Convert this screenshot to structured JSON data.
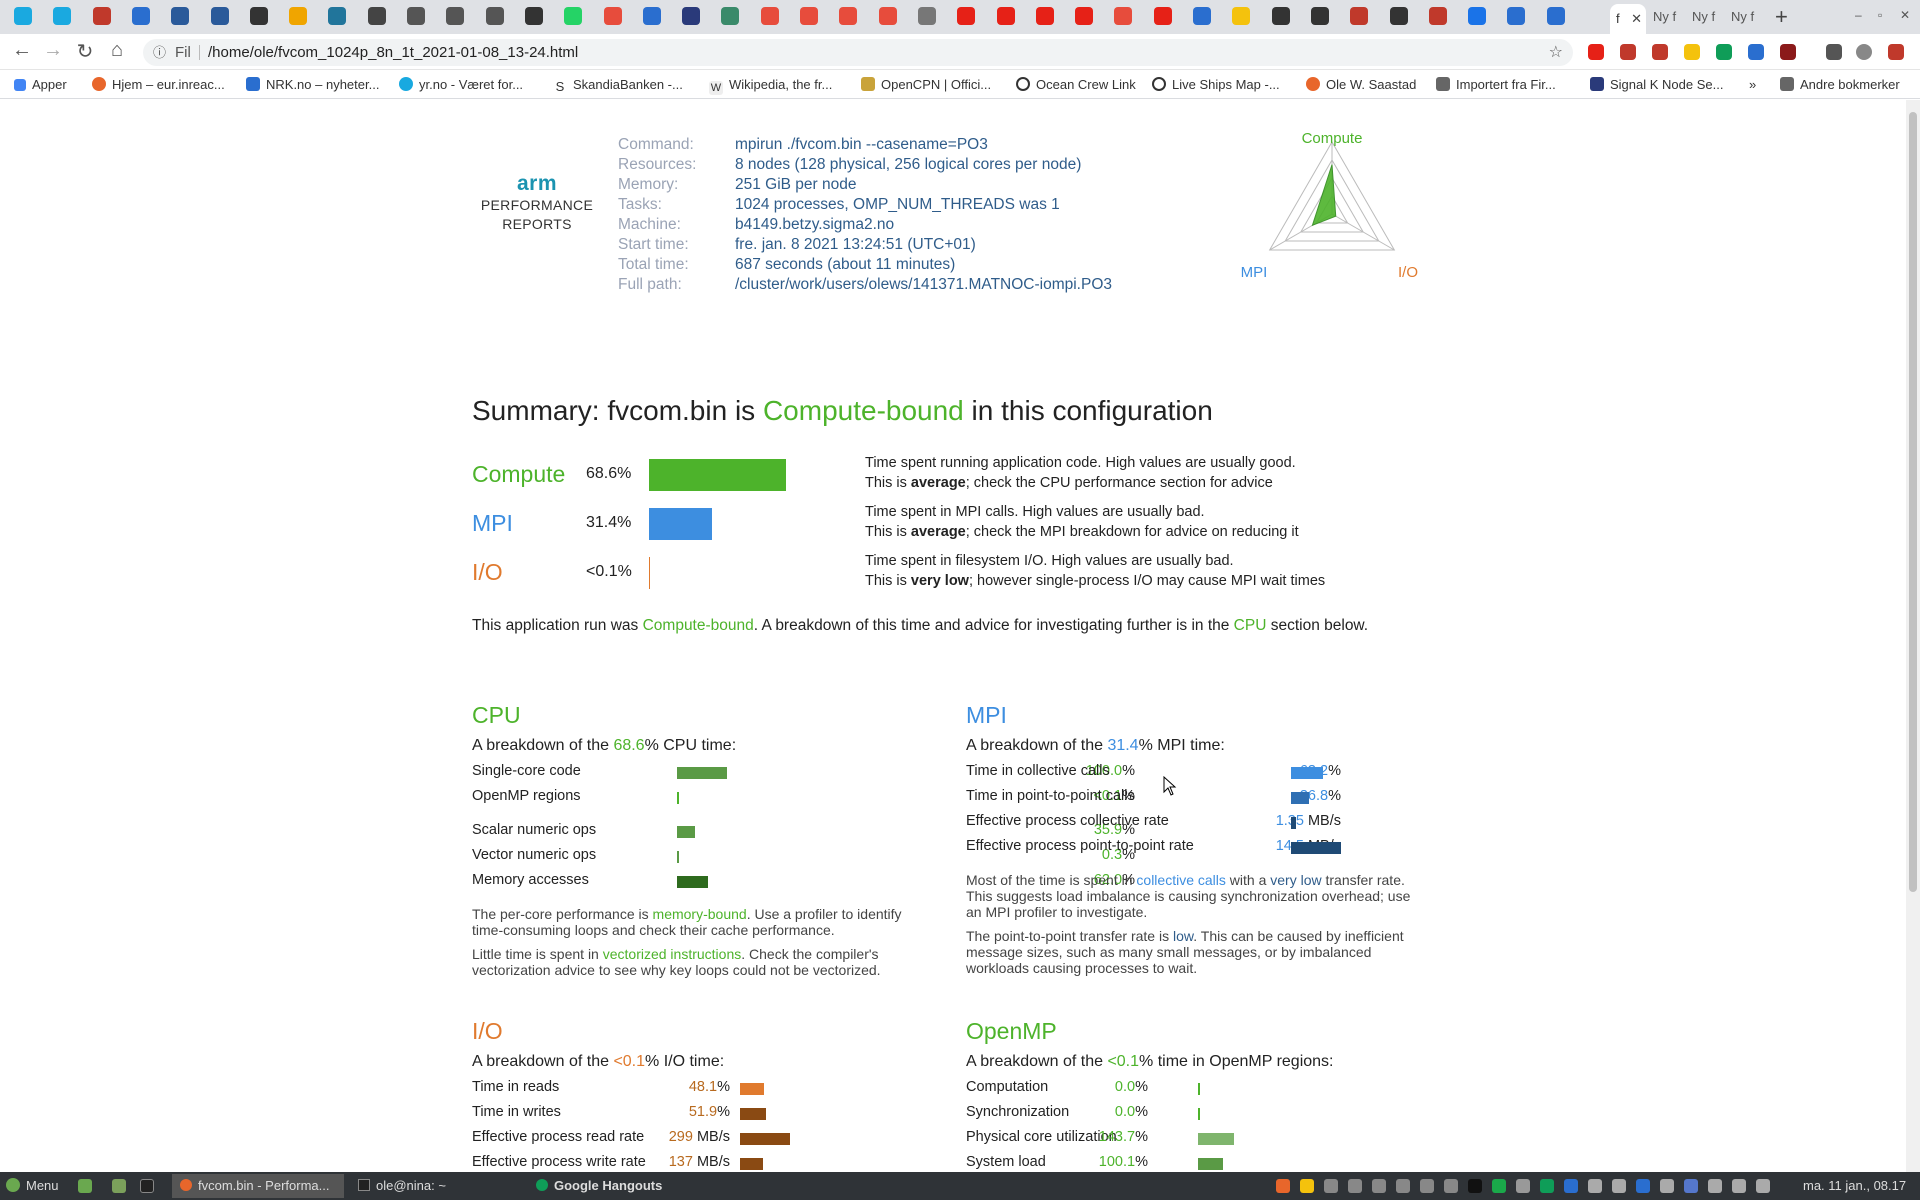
{
  "browser": {
    "tabs_right": [
      "Ny f",
      "Ny f",
      "Ny f"
    ],
    "active_tab_label": "f",
    "address_scheme": "Fil",
    "url": "/home/ole/fvcom_1024p_8n_1t_2021-01-08_13-24.html",
    "bookmarks": [
      "Apper",
      "Hjem – eur.inreac...",
      "NRK.no – nyheter...",
      "yr.no - Været for...",
      "SkandiaBanken -...",
      "Wikipedia, the fr...",
      "OpenCPN | Offici...",
      "Ocean Crew Link",
      "Live Ships Map -...",
      "Ole W. Saastad",
      "Importert fra Fir...",
      "Signal K Node Se...",
      "Andre bokmerker"
    ]
  },
  "report": {
    "logo_brand": "arm",
    "logo_line1": "PERFORMANCE",
    "logo_line2": "REPORTS",
    "meta": [
      {
        "key": "Command:",
        "value": "mpirun ./fvcom.bin --casename=PO3"
      },
      {
        "key": "Resources:",
        "value": "8 nodes (128 physical, 256 logical cores per node)"
      },
      {
        "key": "Memory:",
        "value": "251 GiB per node"
      },
      {
        "key": "Tasks:",
        "value": "1024 processes, OMP_NUM_THREADS was 1"
      },
      {
        "key": "Machine:",
        "value": "b4149.betzy.sigma2.no"
      },
      {
        "key": "Start time:",
        "value": "fre. jan. 8 2021 13:24:51 (UTC+01)"
      },
      {
        "key": "Total time:",
        "value": "687 seconds (about 11 minutes)"
      },
      {
        "key": "Full path:",
        "value": "/cluster/work/users/olews/141371.MATNOC-iompi.PO3"
      }
    ],
    "radar": {
      "labels": {
        "top": "Compute",
        "left": "MPI",
        "right": "I/O"
      },
      "values": {
        "compute": 0.686,
        "mpi": 0.314,
        "io": 0.001
      }
    },
    "summary": {
      "title_prefix": "Summary: fvcom.bin is ",
      "title_highlight": "Compute-bound",
      "title_suffix": " in this configuration",
      "rows": [
        {
          "label": "Compute",
          "pct": "68.6%",
          "fraction": 0.686,
          "desc1": "Time spent running application code. High values are usually good.",
          "desc2_pre": "This is ",
          "desc2_bold": "average",
          "desc2_post": "; check the CPU performance section for advice"
        },
        {
          "label": "MPI",
          "pct": "31.4%",
          "fraction": 0.314,
          "desc1": "Time spent in MPI calls. High values are usually bad.",
          "desc2_pre": "This is ",
          "desc2_bold": "average",
          "desc2_post": "; check the MPI breakdown for advice on reducing it"
        },
        {
          "label": "I/O",
          "pct": "<0.1%",
          "fraction": 0.001,
          "desc1": "Time spent in filesystem I/O. High values are usually bad.",
          "desc2_pre": "This is ",
          "desc2_bold": "very low",
          "desc2_post": "; however single-process I/O may cause MPI wait times"
        }
      ],
      "conclusion_pre": "This application run was ",
      "conclusion_hl1": "Compute-bound",
      "conclusion_mid": ". A breakdown of this time and advice for investigating further is in the ",
      "conclusion_hl2": "CPU",
      "conclusion_post": " section below."
    },
    "cpu": {
      "title": "CPU",
      "sub_pre": "A breakdown of the ",
      "sub_val": "68.6",
      "sub_post": "% CPU time:",
      "rows": [
        {
          "label": "Single-core code",
          "value": "100.0",
          "unit": "%",
          "fraction": 1.0
        },
        {
          "label": "OpenMP regions",
          "value": "<0.1",
          "unit": "%",
          "fraction": 0.0
        },
        {
          "label": "Scalar numeric ops",
          "value": "35.9",
          "unit": "%",
          "fraction": 0.359
        },
        {
          "label": "Vector numeric ops",
          "value": "0.3",
          "unit": "%",
          "fraction": 0.003
        },
        {
          "label": "Memory accesses",
          "value": "62.0",
          "unit": "%",
          "fraction": 0.62
        }
      ],
      "para1_pre": "The per-core performance is ",
      "para1_hl": "memory-bound",
      "para1_post": ". Use a profiler to identify time-consuming loops and check their cache performance.",
      "para2_pre": "Little time is spent in ",
      "para2_hl": "vectorized instructions",
      "para2_post": ". Check the compiler's vectorization advice to see why key loops could not be vectorized."
    },
    "mpi": {
      "title": "MPI",
      "sub_pre": "A breakdown of the ",
      "sub_val": "31.4",
      "sub_post": "% MPI time:",
      "rows": [
        {
          "label": "Time in collective calls",
          "value": "63.2",
          "unit": "%",
          "fraction": 0.632
        },
        {
          "label": "Time in point-to-point calls",
          "value": "36.8",
          "unit": "%",
          "fraction": 0.368
        },
        {
          "label": "Effective process collective rate",
          "value": "1.35",
          "unit": "MB/s",
          "fraction": 0.09
        },
        {
          "label": "Effective process point-to-point rate",
          "value": "14.5",
          "unit": "MB/s",
          "fraction": 1.0
        }
      ],
      "para1_pre": "Most of the time is spent in ",
      "para1_hl": "collective calls",
      "para1_mid": " with a ",
      "para1_hl2": "very low",
      "para1_post": " transfer rate. This suggests load imbalance is causing synchronization overhead; use an MPI profiler to investigate.",
      "para2_pre": "The point-to-point transfer rate is ",
      "para2_hl": "low",
      "para2_post": ". This can be caused by inefficient message sizes, such as many small messages, or by imbalanced workloads causing processes to wait."
    },
    "io": {
      "title": "I/O",
      "sub_pre": "A breakdown of the ",
      "sub_val": "<0.1",
      "sub_post": "% I/O time:",
      "rows": [
        {
          "label": "Time in reads",
          "value": "48.1",
          "unit": "%",
          "fraction": 0.481
        },
        {
          "label": "Time in writes",
          "value": "51.9",
          "unit": "%",
          "fraction": 0.519
        },
        {
          "label": "Effective process read rate",
          "value": "299",
          "unit": "MB/s",
          "fraction": 1.0
        },
        {
          "label": "Effective process write rate",
          "value": "137",
          "unit": "MB/s",
          "fraction": 0.46
        }
      ]
    },
    "openmp": {
      "title": "OpenMP",
      "sub_pre": "A breakdown of the ",
      "sub_val": "<0.1",
      "sub_post": "% time in OpenMP regions:",
      "rows": [
        {
          "label": "Computation",
          "value": "0.0",
          "unit": "%",
          "fraction": 0.0
        },
        {
          "label": "Synchronization",
          "value": "0.0",
          "unit": "%",
          "fraction": 0.0
        },
        {
          "label": "Physical core utilization",
          "value": "143.7",
          "unit": "%",
          "fraction": 1.0
        },
        {
          "label": "System load",
          "value": "100.1",
          "unit": "%",
          "fraction": 0.7
        }
      ]
    }
  },
  "taskbar": {
    "menu_label": "Menu",
    "tasks": [
      "fvcom.bin - Performa...",
      "ole@nina: ~",
      "Google Hangouts"
    ],
    "clock": "ma. 11 jan., 08.17"
  },
  "colors": {
    "compute": "#4db32b",
    "mpi": "#3d8ee0",
    "io": "#e07a2e",
    "cpu_bar": "#5a9a45",
    "cpu_bar_dark": "#2e6b1e",
    "mpi_bar": "#2f6fb3",
    "mpi_bar_dark": "#1f4a75",
    "io_bar_light": "#e07a2e",
    "io_bar_dark": "#8a4a13",
    "omp_bar": "#7fb56d"
  }
}
